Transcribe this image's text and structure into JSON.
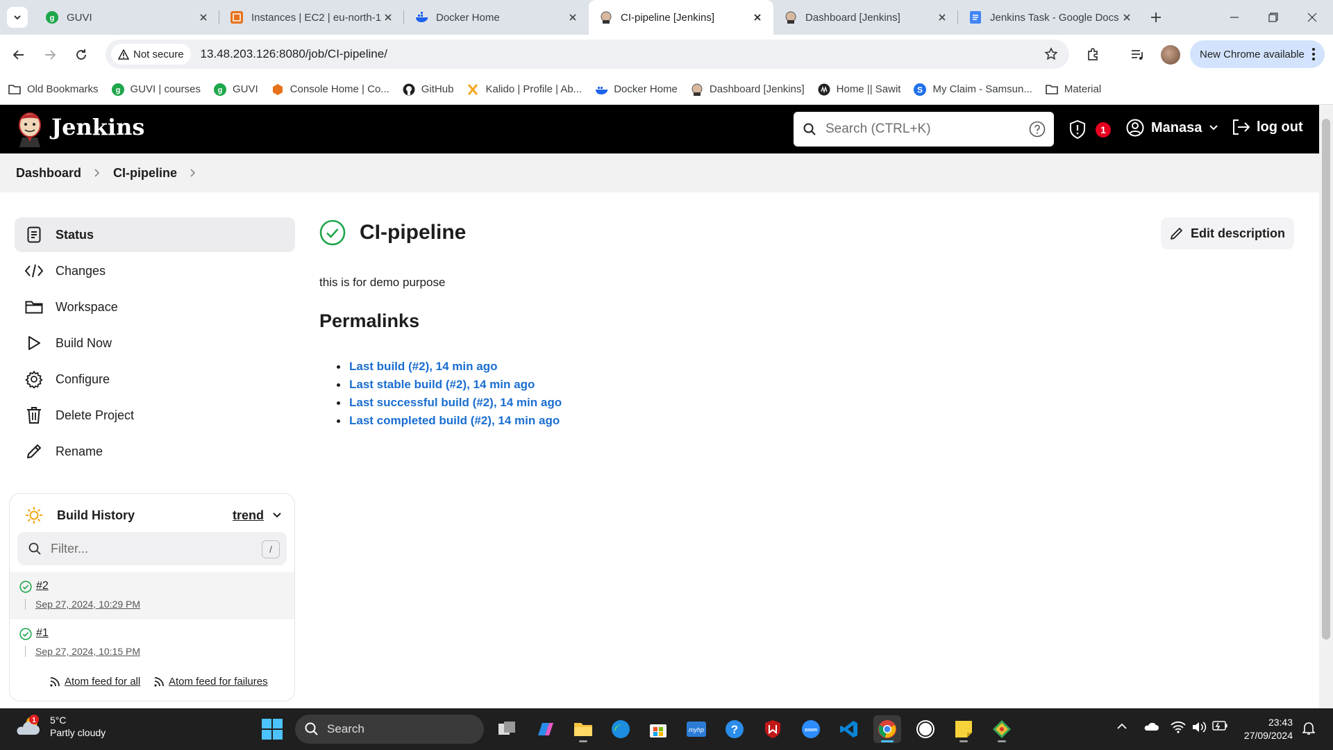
{
  "browser": {
    "tabs": [
      {
        "title": "GUVI",
        "active": false
      },
      {
        "title": "Instances | EC2 | eu-north-1",
        "active": false
      },
      {
        "title": "Docker Home",
        "active": false
      },
      {
        "title": "CI-pipeline [Jenkins]",
        "active": true
      },
      {
        "title": "Dashboard [Jenkins]",
        "active": false
      },
      {
        "title": "Jenkins Task - Google Docs",
        "active": false
      }
    ],
    "security_label": "Not secure",
    "url": "13.48.203.126:8080/job/CI-pipeline/",
    "update_label": "New Chrome available",
    "bookmarks": [
      "Old Bookmarks",
      "GUVI | courses",
      "GUVI",
      "Console Home | Co...",
      "GitHub",
      "Kalido | Profile | Ab...",
      "Docker Home",
      "Dashboard [Jenkins]",
      "Home || Sawit",
      "My Claim - Samsun...",
      "Material"
    ]
  },
  "jenkins": {
    "brand": "Jenkins",
    "search_placeholder": "Search (CTRL+K)",
    "security_count": "1",
    "user": "Manasa",
    "logout_label": "log out",
    "breadcrumb": [
      "Dashboard",
      "CI-pipeline"
    ],
    "sidebar": [
      {
        "label": "Status",
        "icon": "document-icon",
        "active": true
      },
      {
        "label": "Changes",
        "icon": "code-icon",
        "active": false
      },
      {
        "label": "Workspace",
        "icon": "folder-icon",
        "active": false
      },
      {
        "label": "Build Now",
        "icon": "play-icon",
        "active": false
      },
      {
        "label": "Configure",
        "icon": "gear-icon",
        "active": false
      },
      {
        "label": "Delete Project",
        "icon": "trash-icon",
        "active": false
      },
      {
        "label": "Rename",
        "icon": "pencil-icon",
        "active": false
      }
    ],
    "build_history": {
      "title": "Build History",
      "trend_label": "trend",
      "filter_placeholder": "Filter...",
      "filter_shortcut": "/",
      "builds": [
        {
          "number": "#2",
          "date": "Sep 27, 2024, 10:29 PM",
          "status": "success"
        },
        {
          "number": "#1",
          "date": "Sep 27, 2024, 10:15 PM",
          "status": "success"
        }
      ],
      "atom_all": "Atom feed for all",
      "atom_failures": "Atom feed for failures"
    },
    "job": {
      "title": "CI-pipeline",
      "edit_description_label": "Edit description",
      "description": "this is for demo purpose",
      "permalinks_heading": "Permalinks",
      "permalinks": [
        "Last build (#2), 14 min ago",
        "Last stable build (#2), 14 min ago",
        "Last successful build (#2), 14 min ago",
        "Last completed build (#2), 14 min ago"
      ]
    }
  },
  "taskbar": {
    "weather_temp": "5°C",
    "weather_text": "Partly cloudy",
    "weather_badge": "1",
    "search_label": "Search",
    "time": "23:43",
    "date": "27/09/2024"
  },
  "colors": {
    "link": "#1a6ed0",
    "success": "#1ea64b",
    "header_bg": "#000000",
    "badge": "#e6001f"
  }
}
